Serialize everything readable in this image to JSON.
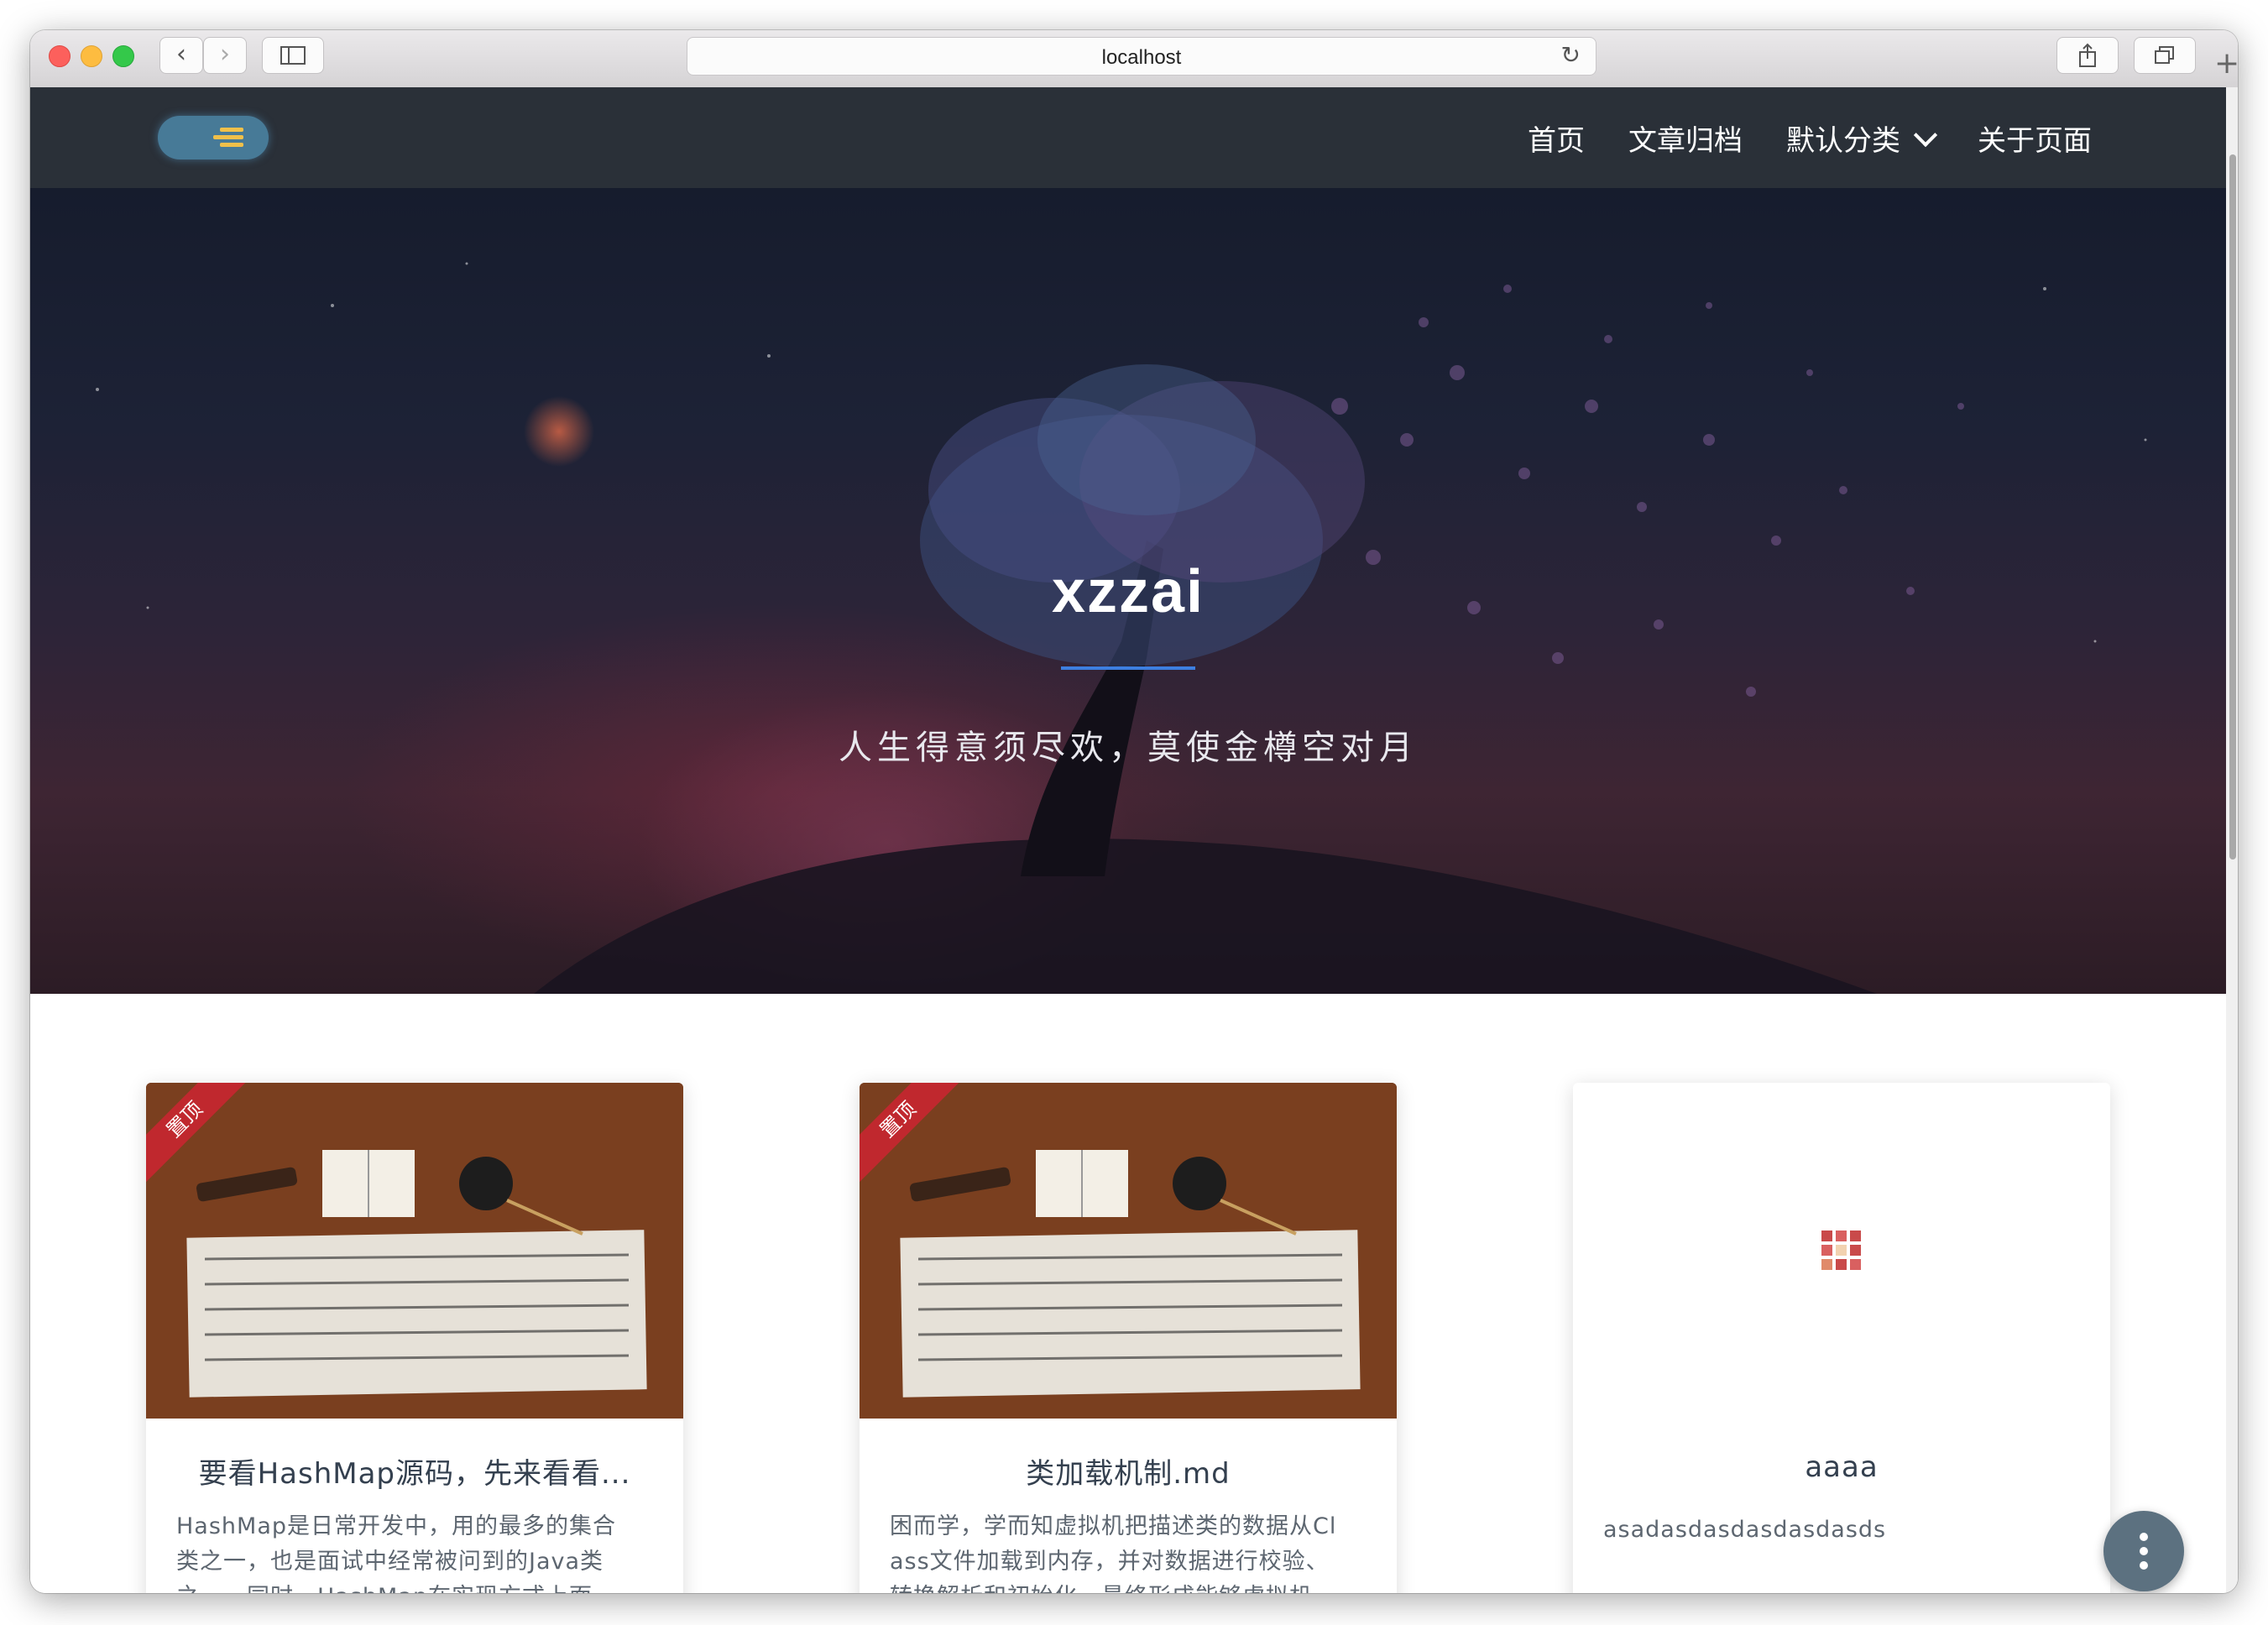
{
  "browser": {
    "url": "localhost"
  },
  "nav": {
    "items": [
      {
        "label": "首页"
      },
      {
        "label": "文章归档"
      },
      {
        "label": "默认分类"
      },
      {
        "label": "关于页面"
      }
    ]
  },
  "hero": {
    "title": "xzzai",
    "subtitle": "人生得意须尽欢，莫使金樽空对月"
  },
  "posts": [
    {
      "title": "要看HashMap源码，先来看看...",
      "badge": "置顶",
      "excerpt_lines": [
        "HashMap是日常开发中，用的最多的集合",
        "类之一，也是面试中经常被问到的Java类",
        "之一。同时，HashMap在实现方式上面..."
      ]
    },
    {
      "title": "类加载机制.md",
      "badge": "置顶",
      "excerpt_lines": [
        "困而学，学而知虚拟机把描述类的数据从Cl",
        "ass文件加载到内存，并对数据进行校验、",
        "转换解析和初始化，最终形成能够虚拟机..."
      ]
    },
    {
      "title": "aaaa",
      "excerpt_lines": [
        "asadasdasdasdasdasds"
      ]
    }
  ],
  "colors": {
    "navbar": "#2a3038",
    "accent": "#3d7fe0",
    "ribbon": "#c0282e",
    "fab": "#5c7180"
  }
}
